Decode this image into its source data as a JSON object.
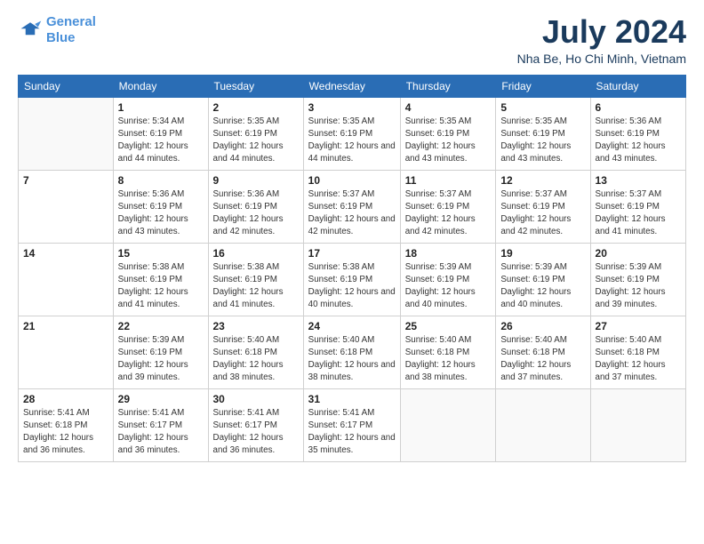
{
  "logo": {
    "line1": "General",
    "line2": "Blue"
  },
  "header": {
    "month": "July 2024",
    "location": "Nha Be, Ho Chi Minh, Vietnam"
  },
  "days_of_week": [
    "Sunday",
    "Monday",
    "Tuesday",
    "Wednesday",
    "Thursday",
    "Friday",
    "Saturday"
  ],
  "weeks": [
    [
      {
        "day": "",
        "info": ""
      },
      {
        "day": "1",
        "info": "Sunrise: 5:34 AM\nSunset: 6:19 PM\nDaylight: 12 hours\nand 44 minutes."
      },
      {
        "day": "2",
        "info": "Sunrise: 5:35 AM\nSunset: 6:19 PM\nDaylight: 12 hours\nand 44 minutes."
      },
      {
        "day": "3",
        "info": "Sunrise: 5:35 AM\nSunset: 6:19 PM\nDaylight: 12 hours\nand 44 minutes."
      },
      {
        "day": "4",
        "info": "Sunrise: 5:35 AM\nSunset: 6:19 PM\nDaylight: 12 hours\nand 43 minutes."
      },
      {
        "day": "5",
        "info": "Sunrise: 5:35 AM\nSunset: 6:19 PM\nDaylight: 12 hours\nand 43 minutes."
      },
      {
        "day": "6",
        "info": "Sunrise: 5:36 AM\nSunset: 6:19 PM\nDaylight: 12 hours\nand 43 minutes."
      }
    ],
    [
      {
        "day": "7",
        "info": ""
      },
      {
        "day": "8",
        "info": "Sunrise: 5:36 AM\nSunset: 6:19 PM\nDaylight: 12 hours\nand 43 minutes."
      },
      {
        "day": "9",
        "info": "Sunrise: 5:36 AM\nSunset: 6:19 PM\nDaylight: 12 hours\nand 42 minutes."
      },
      {
        "day": "10",
        "info": "Sunrise: 5:37 AM\nSunset: 6:19 PM\nDaylight: 12 hours\nand 42 minutes."
      },
      {
        "day": "11",
        "info": "Sunrise: 5:37 AM\nSunset: 6:19 PM\nDaylight: 12 hours\nand 42 minutes."
      },
      {
        "day": "12",
        "info": "Sunrise: 5:37 AM\nSunset: 6:19 PM\nDaylight: 12 hours\nand 42 minutes."
      },
      {
        "day": "13",
        "info": "Sunrise: 5:37 AM\nSunset: 6:19 PM\nDaylight: 12 hours\nand 41 minutes."
      }
    ],
    [
      {
        "day": "14",
        "info": ""
      },
      {
        "day": "15",
        "info": "Sunrise: 5:38 AM\nSunset: 6:19 PM\nDaylight: 12 hours\nand 41 minutes."
      },
      {
        "day": "16",
        "info": "Sunrise: 5:38 AM\nSunset: 6:19 PM\nDaylight: 12 hours\nand 41 minutes."
      },
      {
        "day": "17",
        "info": "Sunrise: 5:38 AM\nSunset: 6:19 PM\nDaylight: 12 hours\nand 40 minutes."
      },
      {
        "day": "18",
        "info": "Sunrise: 5:39 AM\nSunset: 6:19 PM\nDaylight: 12 hours\nand 40 minutes."
      },
      {
        "day": "19",
        "info": "Sunrise: 5:39 AM\nSunset: 6:19 PM\nDaylight: 12 hours\nand 40 minutes."
      },
      {
        "day": "20",
        "info": "Sunrise: 5:39 AM\nSunset: 6:19 PM\nDaylight: 12 hours\nand 39 minutes."
      }
    ],
    [
      {
        "day": "21",
        "info": ""
      },
      {
        "day": "22",
        "info": "Sunrise: 5:39 AM\nSunset: 6:19 PM\nDaylight: 12 hours\nand 39 minutes."
      },
      {
        "day": "23",
        "info": "Sunrise: 5:40 AM\nSunset: 6:18 PM\nDaylight: 12 hours\nand 38 minutes."
      },
      {
        "day": "24",
        "info": "Sunrise: 5:40 AM\nSunset: 6:18 PM\nDaylight: 12 hours\nand 38 minutes."
      },
      {
        "day": "25",
        "info": "Sunrise: 5:40 AM\nSunset: 6:18 PM\nDaylight: 12 hours\nand 38 minutes."
      },
      {
        "day": "26",
        "info": "Sunrise: 5:40 AM\nSunset: 6:18 PM\nDaylight: 12 hours\nand 37 minutes."
      },
      {
        "day": "27",
        "info": "Sunrise: 5:40 AM\nSunset: 6:18 PM\nDaylight: 12 hours\nand 37 minutes."
      }
    ],
    [
      {
        "day": "28",
        "info": "Sunrise: 5:41 AM\nSunset: 6:18 PM\nDaylight: 12 hours\nand 36 minutes."
      },
      {
        "day": "29",
        "info": "Sunrise: 5:41 AM\nSunset: 6:17 PM\nDaylight: 12 hours\nand 36 minutes."
      },
      {
        "day": "30",
        "info": "Sunrise: 5:41 AM\nSunset: 6:17 PM\nDaylight: 12 hours\nand 36 minutes."
      },
      {
        "day": "31",
        "info": "Sunrise: 5:41 AM\nSunset: 6:17 PM\nDaylight: 12 hours\nand 35 minutes."
      },
      {
        "day": "",
        "info": ""
      },
      {
        "day": "",
        "info": ""
      },
      {
        "day": "",
        "info": ""
      }
    ]
  ]
}
